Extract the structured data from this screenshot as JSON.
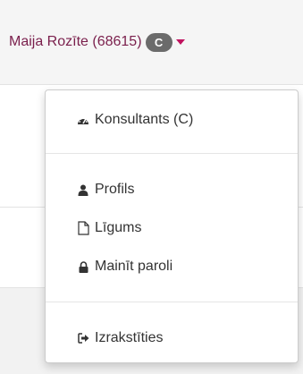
{
  "header": {
    "user_name": "Maija Rozīte (68615)",
    "role_badge": "C",
    "accent_color": "#7a1f4c",
    "caret_color": "#c0125e"
  },
  "menu": {
    "items": [
      {
        "label": "Konsultants (C)",
        "icon": "dashboard-icon"
      },
      {
        "label": "Profils",
        "icon": "user-icon"
      },
      {
        "label": "Līgums",
        "icon": "document-icon"
      },
      {
        "label": "Mainīt paroli",
        "icon": "lock-icon"
      },
      {
        "label": "Izrakstīties",
        "icon": "sign-out-icon"
      }
    ]
  }
}
